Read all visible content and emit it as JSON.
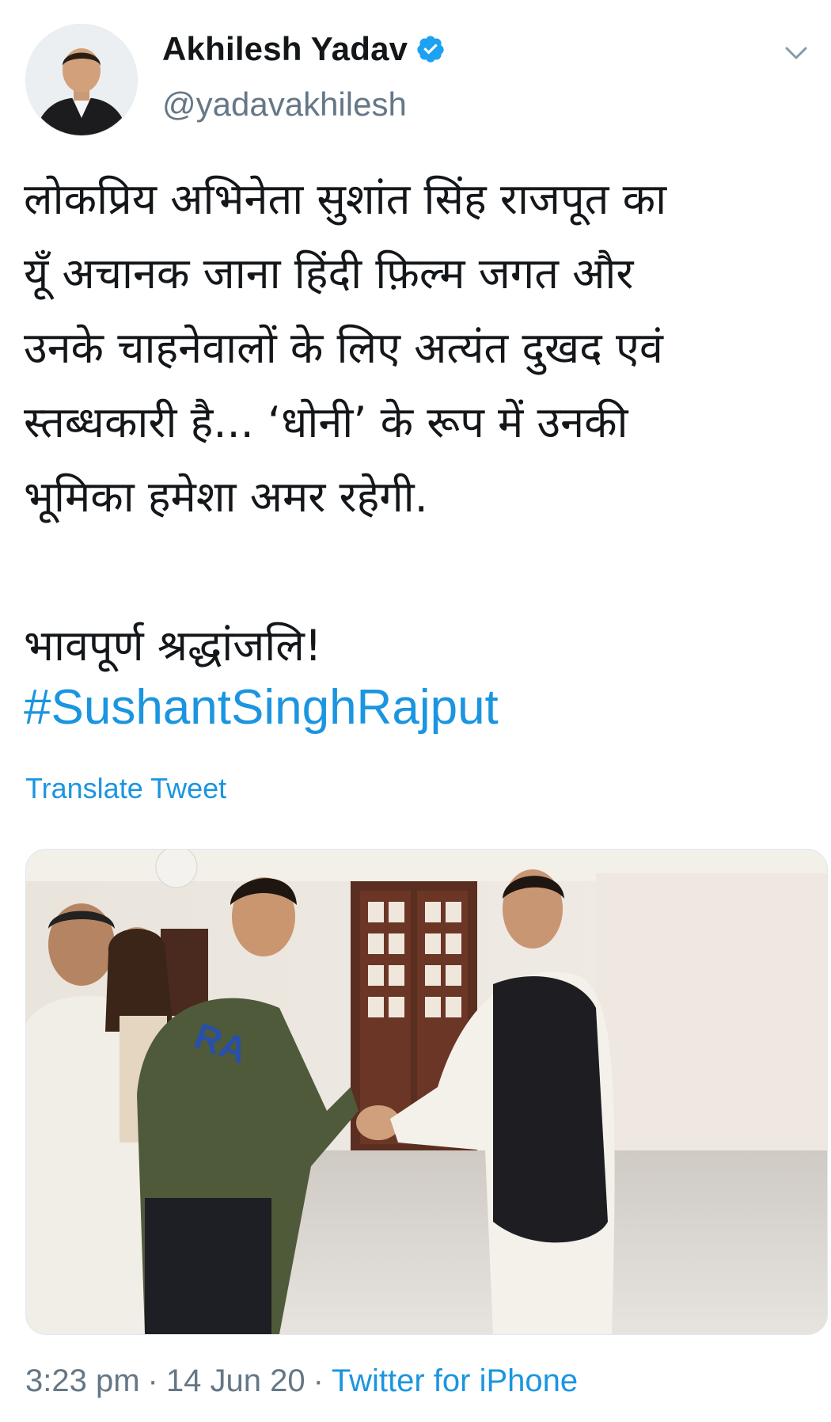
{
  "author": {
    "display_name": "Akhilesh Yadav",
    "handle": "@yadavakhilesh",
    "verified": true,
    "avatar_icon": "profile-photo"
  },
  "tweet": {
    "lines": [
      "लोकप्रिय अभिनेता सुशांत सिंह राजपूत का",
      "यूँ अचानक जाना हिंदी फ़िल्म जगत और",
      "उनके चाहनेवालों के लिए अत्यंत दुखद एवं",
      "स्तब्धकारी है... ‘धोनी’ के रूप में उनकी",
      "भूमिका हमेशा अमर रहेगी."
    ],
    "tribute": "भावपूर्ण श्रद्धांजलि!",
    "hashtag": "#SushantSinghRajput",
    "translate_label": "Translate Tweet"
  },
  "metadata": {
    "time": "3:23 pm",
    "date": "14 Jun 20",
    "separator": "·",
    "source": "Twitter for iPhone"
  },
  "colors": {
    "link": "#1b95e0",
    "secondary": "#657786",
    "primary_text": "#14171a"
  },
  "icons": {
    "verified": "verified-badge-icon",
    "menu": "chevron-down-icon"
  }
}
